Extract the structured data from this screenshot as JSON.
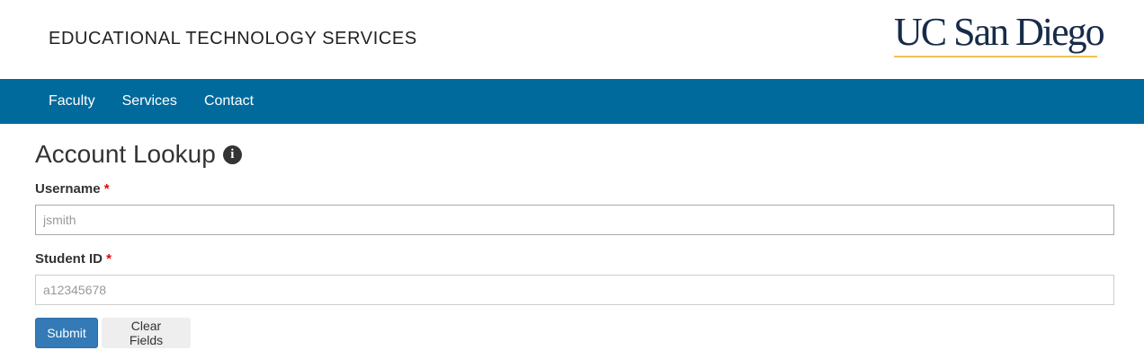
{
  "header": {
    "site_title": "EDUCATIONAL TECHNOLOGY SERVICES",
    "logo": "UC San Diego"
  },
  "nav": {
    "items": [
      {
        "label": "Faculty"
      },
      {
        "label": "Services"
      },
      {
        "label": "Contact"
      }
    ]
  },
  "page": {
    "title": "Account Lookup",
    "info_icon": "info-circle-icon"
  },
  "form": {
    "username": {
      "label": "Username",
      "required_mark": "*",
      "placeholder": "jsmith",
      "value": ""
    },
    "student_id": {
      "label": "Student ID",
      "required_mark": "*",
      "placeholder": "a12345678",
      "value": ""
    },
    "submit_label": "Submit",
    "clear_label": "Clear Fields"
  },
  "colors": {
    "nav_bg": "#006a9c",
    "logo_navy": "#182b49",
    "logo_gold": "#f3c156",
    "submit_bg": "#337ab7",
    "required": "#e00000"
  }
}
